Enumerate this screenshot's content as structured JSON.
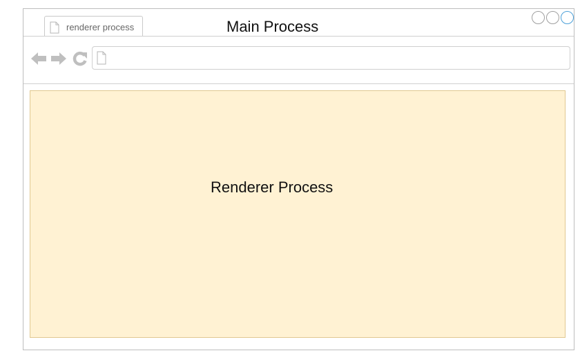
{
  "tab": {
    "label": "renderer process"
  },
  "main_process_label": "Main Process",
  "renderer_process_label": "Renderer Process",
  "icons": {
    "tab_icon": "document-icon",
    "back": "back-arrow-icon",
    "forward": "forward-arrow-icon",
    "reload": "reload-icon",
    "address_icon": "document-icon"
  },
  "colors": {
    "renderer_fill": "#fff2d3",
    "renderer_border": "#e0c890",
    "window_border": "#bdbdbd",
    "nav_icon": "#bfbfbf",
    "active_control": "#4a9fd8"
  }
}
